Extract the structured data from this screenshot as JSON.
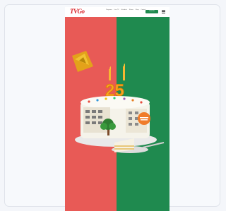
{
  "page": {
    "background": "#f4f6fa"
  },
  "header": {
    "logo_text": "TVGo",
    "nav_links": [
      "Programs",
      "Live TV",
      "Schedule",
      "Shows",
      "Shop",
      "Contact"
    ],
    "cta_label": "SIGN IN",
    "menu_icon": "hamburger-icon"
  },
  "colors": {
    "left_panel": "#e85a56",
    "right_panel": "#1f8a4f",
    "brand": "#d81f26"
  },
  "hero": {
    "anniversary_number": "25",
    "cake_icon": "anniversary-cake-icon",
    "badge_icon": "orange-badge-icon",
    "tree_icon": "tree-icon",
    "plate_icon": "plate-icon",
    "snack_icon": "nachos-icon"
  }
}
